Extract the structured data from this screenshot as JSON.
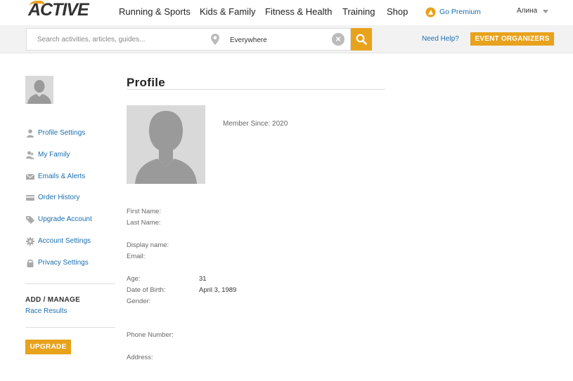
{
  "header": {
    "logo_text": "ACTIVE",
    "nav": [
      {
        "label": "Running & Sports"
      },
      {
        "label": "Kids & Family"
      },
      {
        "label": "Fitness & Health"
      },
      {
        "label": "Training"
      },
      {
        "label": "Shop"
      }
    ],
    "premium_label": "Go Premium",
    "user_name": "Алина"
  },
  "search": {
    "placeholder": "Search activities, articles, guides...",
    "location_value": "Everywhere",
    "clear_glyph": "×",
    "help_label": "Need Help?",
    "organizers_label": "EVENT ORGANIZERS"
  },
  "sidebar": {
    "items": [
      {
        "label": "Profile Settings",
        "icon": "person-icon"
      },
      {
        "label": "My Family",
        "icon": "family-icon"
      },
      {
        "label": "Emails & Alerts",
        "icon": "envelope-icon"
      },
      {
        "label": "Order History",
        "icon": "credit-card-icon"
      },
      {
        "label": "Upgrade Account",
        "icon": "tag-icon"
      },
      {
        "label": "Account Settings",
        "icon": "gear-icon"
      },
      {
        "label": "Privacy Settings",
        "icon": "lock-icon"
      }
    ],
    "add_manage_heading": "ADD / MANAGE",
    "race_results_label": "Race Results",
    "upgrade_label": "UPGRADE"
  },
  "profile": {
    "title": "Profile",
    "member_since": "Member Since: 2020",
    "fields": {
      "first_name": "First Name:",
      "last_name": "Last Name:",
      "display_name": "Display name:",
      "email": "Email:",
      "age_label": "Age:",
      "age_value": "31",
      "dob_label": "Date of Birth:",
      "dob_value": "April 3, 1989",
      "gender": "Gender:",
      "phone": "Phone Number:",
      "address": "Address:"
    }
  },
  "colors": {
    "accent": "#e8a21c",
    "link": "#1a6fb0",
    "placeholder_gray": "#d9d9d9"
  }
}
